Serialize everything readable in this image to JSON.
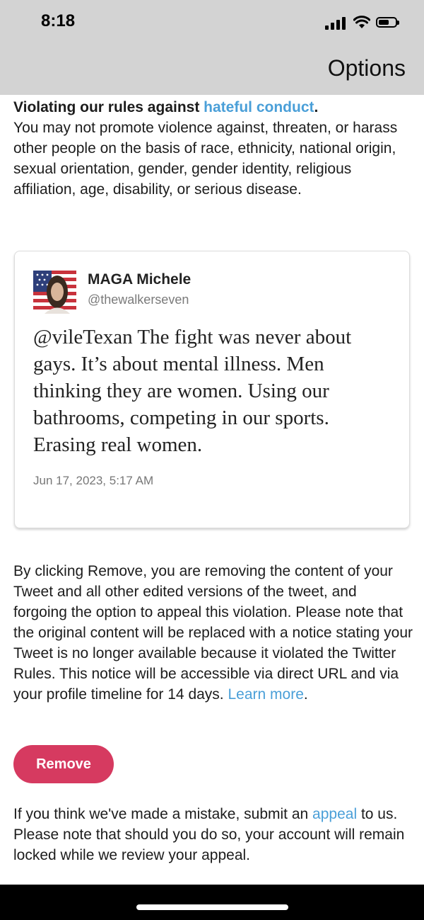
{
  "status_bar": {
    "time": "8:18",
    "icons": [
      "cellular-signal-icon",
      "wifi-icon",
      "battery-icon"
    ]
  },
  "header": {
    "title": "Options"
  },
  "violation": {
    "title_prefix": "Violating our rules against ",
    "title_link": "hateful conduct",
    "title_suffix": ".",
    "description": "You may not promote violence against, threaten, or harass other people on the basis of race, ethnicity, national origin, sexual orientation, gender, gender identity, religious affiliation, age, disability, or serious disease."
  },
  "tweet": {
    "display_name": "MAGA Michele",
    "handle": "@thewalkerseven",
    "text": "@vileTexan The fight was never about gays. It’s about mental illness. Men thinking they are women. Using our bathrooms, competing in our sports. Erasing real women.",
    "date": "Jun 17, 2023, 5:17 AM"
  },
  "remove_notice": {
    "text": "By clicking Remove, you are removing the content of your Tweet and all other edited versions of the tweet, and forgoing the option to appeal this violation. Please note that the original content will be replaced with a notice stating your Tweet is no longer available because it violated the Twitter Rules. This notice will be accessible via direct URL and via your profile timeline for 14 days. ",
    "link": "Learn more",
    "suffix": "."
  },
  "remove_button": {
    "label": "Remove"
  },
  "appeal_notice": {
    "prefix": "If you think we've made a mistake, submit an ",
    "link": "appeal",
    "suffix": " to us. Please note that should you do so, your account will remain locked while we review your appeal."
  },
  "colors": {
    "header_bg": "#d3d3d3",
    "link": "#4a9fd8",
    "remove_button": "#d63a60",
    "text": "#1c1c1c"
  }
}
